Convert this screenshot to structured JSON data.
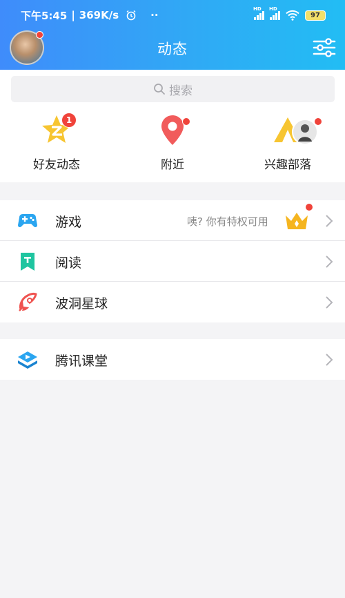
{
  "status": {
    "time": "下午5:45",
    "speed": "369K/s",
    "dots": "··",
    "hd": "HD",
    "battery": "97"
  },
  "header": {
    "title": "动态"
  },
  "search": {
    "placeholder": "搜索"
  },
  "quick_actions": [
    {
      "label": "好友动态",
      "badge": "1",
      "icon": "friend-feed-star-icon"
    },
    {
      "label": "附近",
      "icon": "location-pin-icon"
    },
    {
      "label": "兴趣部落",
      "icon": "tent-tribe-icon"
    }
  ],
  "menu_group_1": [
    {
      "label": "游戏",
      "hint": "咦? 你有特权可用",
      "icon": "gamepad-icon"
    },
    {
      "label": "阅读",
      "icon": "bookmark-read-icon"
    },
    {
      "label": "波洞星球",
      "icon": "rocket-planet-icon"
    }
  ],
  "menu_group_2": [
    {
      "label": "腾讯课堂",
      "icon": "classroom-play-icon"
    }
  ],
  "colors": {
    "header_start": "#3f8cfb",
    "header_end": "#22bdf4",
    "badge_red": "#f0433a",
    "background": "#f4f4f6"
  }
}
